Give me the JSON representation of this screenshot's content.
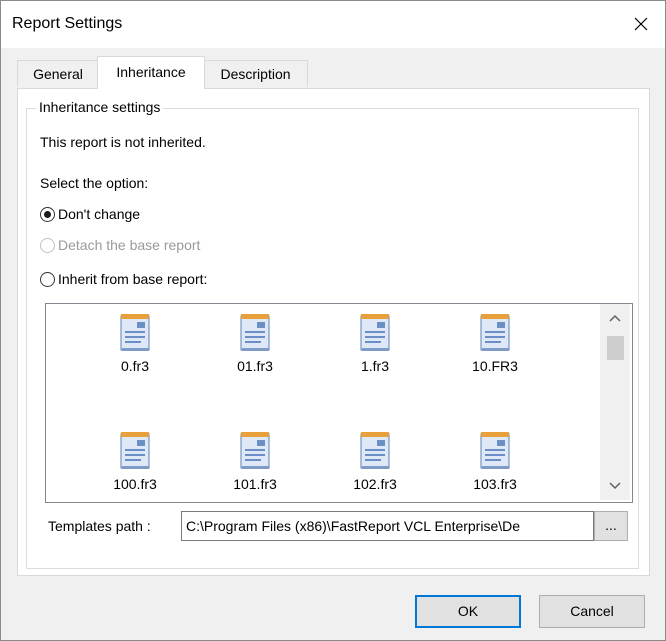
{
  "window": {
    "title": "Report Settings"
  },
  "tabs": [
    {
      "label": "General"
    },
    {
      "label": "Inheritance"
    },
    {
      "label": "Description"
    }
  ],
  "inheritance": {
    "group_label": "Inheritance settings",
    "status_text": "This report is not inherited.",
    "select_label": "Select the option:",
    "options": [
      {
        "label": "Don't change",
        "checked": true,
        "enabled": true
      },
      {
        "label": "Detach the base report",
        "checked": false,
        "enabled": false
      },
      {
        "label": "Inherit from base report:",
        "checked": false,
        "enabled": true
      }
    ],
    "templates": [
      {
        "name": "0.fr3"
      },
      {
        "name": "01.fr3"
      },
      {
        "name": "1.fr3"
      },
      {
        "name": "10.FR3"
      },
      {
        "name": "100.fr3"
      },
      {
        "name": "101.fr3"
      },
      {
        "name": "102.fr3"
      },
      {
        "name": "103.fr3"
      }
    ],
    "templates_path_label": "Templates path :",
    "templates_path_value": "C:\\Program Files (x86)\\FastReport VCL Enterprise\\De",
    "browse_label": "..."
  },
  "buttons": {
    "ok": "OK",
    "cancel": "Cancel"
  },
  "colors": {
    "accent": "#0078d7",
    "icon_paper": "#6a8fc7",
    "icon_top": "#e8a13a"
  }
}
